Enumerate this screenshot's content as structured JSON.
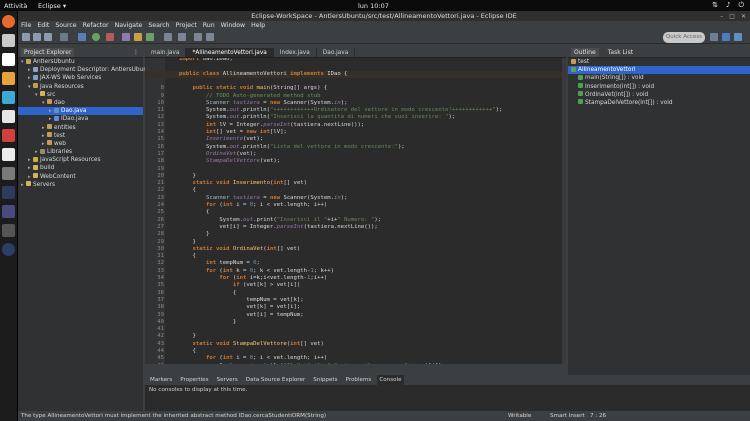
{
  "topbar": {
    "activities": "Attività",
    "app": "Eclipse ▾",
    "clock": "lun 10:07"
  },
  "window": {
    "title": "Eclipse-WorkSpace - AntlersUbuntu/src/test/AllineamentoVettori.java - Eclipse IDE"
  },
  "menu": [
    "File",
    "Edit",
    "Source",
    "Refactor",
    "Navigate",
    "Search",
    "Project",
    "Run",
    "Window",
    "Help"
  ],
  "quick_access": "Quick Access",
  "explorer": {
    "title": "Project Explorer",
    "items": [
      {
        "label": "AntlersUbuntu",
        "indent": 0,
        "twisty": "▾",
        "icon": "project"
      },
      {
        "label": "Deployment Descriptor: AntlersUbunt",
        "indent": 1,
        "twisty": "▸",
        "icon": "descriptor"
      },
      {
        "label": "JAX-WS Web Services",
        "indent": 1,
        "twisty": "▸",
        "icon": "ws"
      },
      {
        "label": "Java Resources",
        "indent": 1,
        "twisty": "▾",
        "icon": "resources"
      },
      {
        "label": "src",
        "indent": 2,
        "twisty": "▾",
        "icon": "folder"
      },
      {
        "label": "dao",
        "indent": 3,
        "twisty": "▾",
        "icon": "package"
      },
      {
        "label": "Dao.java",
        "indent": 4,
        "twisty": "▸",
        "icon": "java",
        "selected": true
      },
      {
        "label": "IDao.java",
        "indent": 4,
        "twisty": "▸",
        "icon": "java"
      },
      {
        "label": "entities",
        "indent": 3,
        "twisty": "▸",
        "icon": "package"
      },
      {
        "label": "test",
        "indent": 3,
        "twisty": "▸",
        "icon": "package"
      },
      {
        "label": "web",
        "indent": 3,
        "twisty": "▸",
        "icon": "package"
      },
      {
        "label": "Libraries",
        "indent": 2,
        "twisty": "▸",
        "icon": "library"
      },
      {
        "label": "JavaScript Resources",
        "indent": 1,
        "twisty": "▸",
        "icon": "js"
      },
      {
        "label": "build",
        "indent": 1,
        "twisty": "▸",
        "icon": "folder"
      },
      {
        "label": "WebContent",
        "indent": 1,
        "twisty": "▸",
        "icon": "folder"
      },
      {
        "label": "Servers",
        "indent": 0,
        "twisty": "▸",
        "icon": "folder"
      }
    ]
  },
  "editor_tabs": [
    "main.java",
    "*AllineamentoVettori.java",
    "Index.java",
    "Dao.java"
  ],
  "code": [
    {
      "n": "",
      "t": "<span class=\"kw\">import</span> dao.IDao;"
    },
    {
      "n": "",
      "t": ""
    },
    {
      "n": "",
      "t": "<span class=\"kw\">public class</span> AllineamentoVettori <span class=\"kw\">implements</span> IDao {"
    },
    {
      "n": "",
      "t": ""
    },
    {
      "n": "8",
      "t": "    <span class=\"kw\">public static void</span> <span class=\"fn\">main</span>(String[] args) {"
    },
    {
      "n": "9",
      "t": "        <span class=\"cm\">// TODO Auto-generated method stub</span>"
    },
    {
      "n": "10",
      "t": "        <span class=\"var\">Scanner</span> <span class=\"it\">tastiera</span> = <span class=\"kw\">new</span> Scanner(System.<span class=\"it\">in</span>);"
    },
    {
      "n": "11",
      "t": "        System.<span class=\"it\">out</span>.println(<span class=\"st\">\"++++++++++++Ordinatore del vettore in modo crescente!++++++++++++\"</span>);"
    },
    {
      "n": "12",
      "t": "        System.<span class=\"it\">out</span>.println(<span class=\"st\">\"Inserisci la quantità di numeri che vuoi inserire: \"</span>);"
    },
    {
      "n": "13",
      "t": "        <span class=\"kw\">int</span> lV = Integer.<span class=\"it\">parseInt</span>(tastiera.nextLine());"
    },
    {
      "n": "14",
      "t": "        <span class=\"kw\">int</span>[] vet = <span class=\"kw\">new</span> <span class=\"kw\">int</span>[lV];"
    },
    {
      "n": "15",
      "t": "        <span class=\"it\">Inserimento</span>(vet);"
    },
    {
      "n": "16",
      "t": "        System.<span class=\"it\">out</span>.println(<span class=\"st\">\"Lista del vettore in modo crescente:\"</span>);"
    },
    {
      "n": "17",
      "t": "        <span class=\"it\">OrdinaVet</span>(vet);"
    },
    {
      "n": "18",
      "t": "        <span class=\"it\">StampaDelVettore</span>(vet);"
    },
    {
      "n": "19",
      "t": ""
    },
    {
      "n": "20",
      "t": "    }"
    },
    {
      "n": "21",
      "t": "    <span class=\"kw\">static void</span> <span class=\"fn\">Inserimento</span>(<span class=\"kw\">int</span>[] vet)"
    },
    {
      "n": "22",
      "t": "    {"
    },
    {
      "n": "23",
      "t": "        <span class=\"var\">Scanner</span> <span class=\"it\">tastiera</span> = <span class=\"kw\">new</span> Scanner(System.<span class=\"it\">in</span>);"
    },
    {
      "n": "24",
      "t": "        <span class=\"kw\">for</span> (<span class=\"kw\">int</span> i = <span class=\"num\">0</span>; i &lt; vet.length; i++)"
    },
    {
      "n": "25",
      "t": "        {"
    },
    {
      "n": "26",
      "t": "            System.<span class=\"it\">out</span>.print(<span class=\"st\">\"Inserisci il \"</span>+i+<span class=\"st\">\" Numero: \"</span>);"
    },
    {
      "n": "27",
      "t": "            vet[i] = Integer.<span class=\"it\">parseInt</span>(tastiera.nextLine());"
    },
    {
      "n": "28",
      "t": "        }"
    },
    {
      "n": "29",
      "t": "    }"
    },
    {
      "n": "30",
      "t": "    <span class=\"kw\">static void</span> <span class=\"fn\">OrdinaVet</span>(<span class=\"kw\">int</span>[] vet)"
    },
    {
      "n": "31",
      "t": "    {"
    },
    {
      "n": "32",
      "t": "        <span class=\"kw\">int</span> tempNum = <span class=\"num\">0</span>;"
    },
    {
      "n": "33",
      "t": "        <span class=\"kw\">for</span> (<span class=\"kw\">int</span> k = <span class=\"num\">0</span>; k &lt; vet.length-<span class=\"num\">1</span>; k++)"
    },
    {
      "n": "34",
      "t": "            <span class=\"kw\">for</span> (<span class=\"kw\">int</span> i=k;i&lt;vet.length-<span class=\"num\">1</span>;i++)"
    },
    {
      "n": "35",
      "t": "                <span class=\"kw\">if</span> (vet[k] &gt; vet[i])"
    },
    {
      "n": "36",
      "t": "                {"
    },
    {
      "n": "37",
      "t": "                    tempNum = vet[k];"
    },
    {
      "n": "38",
      "t": "                    vet[k] = vet[i];"
    },
    {
      "n": "39",
      "t": "                    vet[i] = tempNum;"
    },
    {
      "n": "40",
      "t": "                }"
    },
    {
      "n": "41",
      "t": ""
    },
    {
      "n": "42",
      "t": "    }"
    },
    {
      "n": "43",
      "t": "    <span class=\"kw\">static void</span> <span class=\"fn\">StampaDelVettore</span>(<span class=\"kw\">int</span>[] vet)"
    },
    {
      "n": "44",
      "t": "    {"
    },
    {
      "n": "45",
      "t": "        <span class=\"kw\">for</span> (<span class=\"kw\">int</span> i = <span class=\"num\">0</span>; i &lt; vet.length; i++)"
    },
    {
      "n": "46",
      "t": "            System.<span class=\"it\">out</span>.println(<span class=\"st\">\"Il Vet\"</span> +i+ <span class=\"st\">\" Contiene il numero:  \"</span> + vet[i]);"
    }
  ],
  "outline": {
    "tabs": [
      "Outline",
      "Task List"
    ],
    "items": [
      {
        "label": "test",
        "indent": 0,
        "icon": "package"
      },
      {
        "label": "AllineamentoVettori",
        "indent": 0,
        "icon": "class",
        "selected": true
      },
      {
        "label": "main(String[]) : void",
        "indent": 1,
        "icon": "method"
      },
      {
        "label": "Inserimento(int[]) : void",
        "indent": 1,
        "icon": "method"
      },
      {
        "label": "OrdinaVet(int[]) : void",
        "indent": 1,
        "icon": "method"
      },
      {
        "label": "StampaDelVettore(int[]) : void",
        "indent": 1,
        "icon": "method"
      }
    ]
  },
  "console": {
    "tabs": [
      "Markers",
      "Properties",
      "Servers",
      "Data Source Explorer",
      "Snippets",
      "Problems",
      "Console"
    ],
    "active": "Console",
    "message": "No consoles to display at this time."
  },
  "status": {
    "message": "The type AllineamentoVettori must implement the inherited abstract method IDao.cercaStudentiORM(String)",
    "mode": "Writable",
    "insert": "Smart Insert",
    "position": "7 : 26"
  }
}
